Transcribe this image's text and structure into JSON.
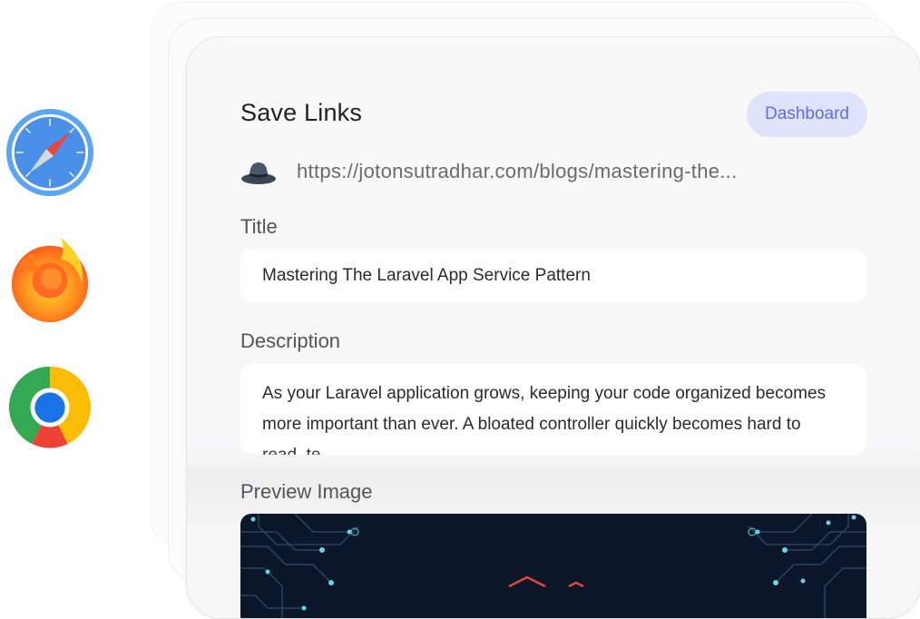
{
  "browsers": [
    {
      "name": "safari-icon"
    },
    {
      "name": "firefox-icon"
    },
    {
      "name": "chrome-icon"
    }
  ],
  "card": {
    "title": "Save Links",
    "dashboard_label": "Dashboard",
    "url": "https://jotonsutradhar.com/blogs/mastering-the...",
    "title_label": "Title",
    "title_value": "Mastering The Laravel App Service Pattern",
    "description_label": "Description",
    "description_value": "As your Laravel application grows, keeping your code organized becomes more important than ever. A bloated controller quickly becomes hard to read, te",
    "preview_label": "Preview Image"
  },
  "colors": {
    "accent": "#5b6ee8",
    "accent_bg": "#dfe3fb",
    "preview_bg": "#0b1628"
  }
}
